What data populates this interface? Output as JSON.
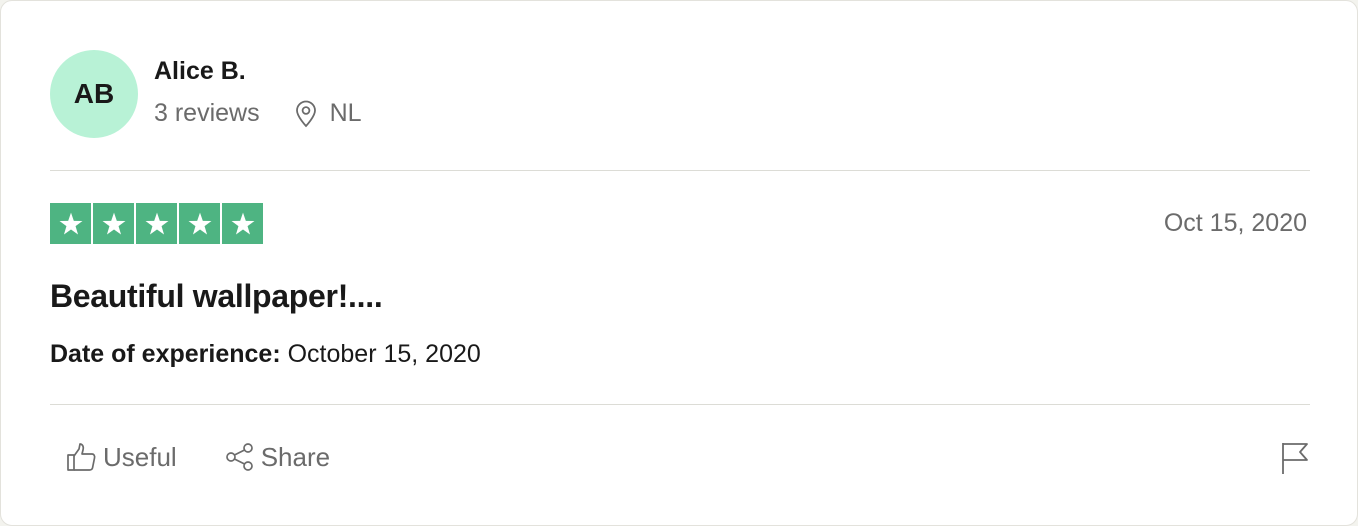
{
  "reviewer": {
    "initials": "AB",
    "name": "Alice B.",
    "reviews": "3 reviews",
    "country": "NL",
    "avatar_color": "#b8f2d6"
  },
  "review": {
    "rating": 5,
    "rating_max": 5,
    "star_color": "#4eb482",
    "date": "Oct 15, 2020",
    "title": "Beautiful wallpaper!....",
    "experience_label": "Date of experience:",
    "experience_date": "October 15, 2020"
  },
  "actions": {
    "useful_label": "Useful",
    "useful_icon": "thumbs-up-icon",
    "share_label": "Share",
    "share_icon": "share-icon",
    "report_icon": "flag-icon"
  }
}
